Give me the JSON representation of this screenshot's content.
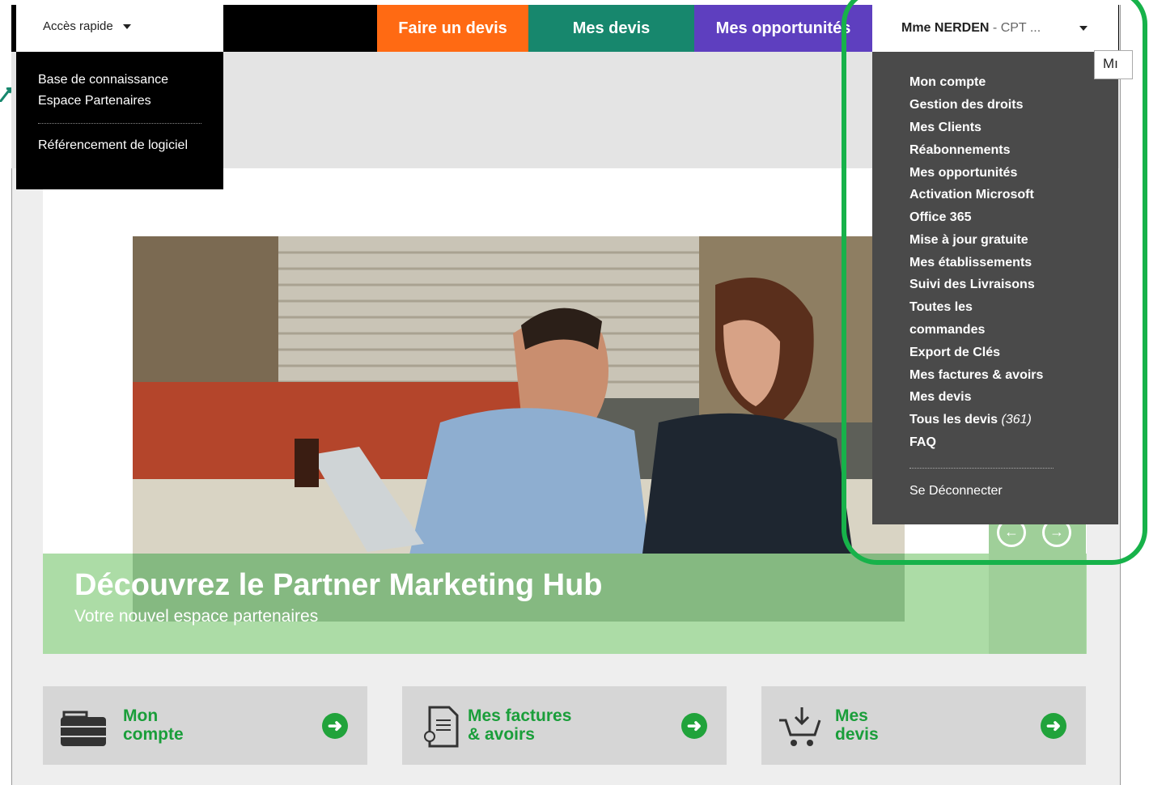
{
  "header": {
    "quick_access": "Accès rapide",
    "nav": {
      "quote": "Faire un devis",
      "my_quotes": "Mes devis",
      "opportunities": "Mes opportunités"
    },
    "user": {
      "name": "Mme NERDEN",
      "separator": " - ",
      "org": "CPT ..."
    },
    "tooltip": "Mı"
  },
  "quick_menu": {
    "items": [
      "Base de connaissance",
      "Espace Partenaires",
      "Référencement de logiciel"
    ]
  },
  "user_menu": {
    "items": [
      "Mon compte",
      "Gestion des droits",
      "Mes Clients",
      "Réabonnements",
      "Mes opportunités",
      "Activation Microsoft",
      "Office 365",
      "Mise à jour gratuite",
      "Mes établissements",
      "Suivi des Livraisons",
      "Toutes les",
      "commandes",
      "Export de Clés",
      "Mes factures & avoirs",
      "Mes devis"
    ],
    "all_quotes": {
      "label": "Tous les devis",
      "count": "(361)"
    },
    "faq": "FAQ",
    "logout": "Se Déconnecter"
  },
  "hero": {
    "title": "Découvrez le Partner Marketing Hub",
    "subtitle": "Votre nouvel espace partenaires"
  },
  "tiles": [
    {
      "line1": "Mon",
      "line2": "compte",
      "icon": "briefcase-icon"
    },
    {
      "line1": "Mes factures",
      "line2": "& avoirs",
      "icon": "invoice-icon"
    },
    {
      "line1": "Mes",
      "line2": "devis",
      "icon": "cart-icon"
    }
  ],
  "colors": {
    "orange": "#ff6a13",
    "teal": "#17876d",
    "purple": "#5e3fbf",
    "green": "#21a33b",
    "highlight": "#17b24a"
  }
}
